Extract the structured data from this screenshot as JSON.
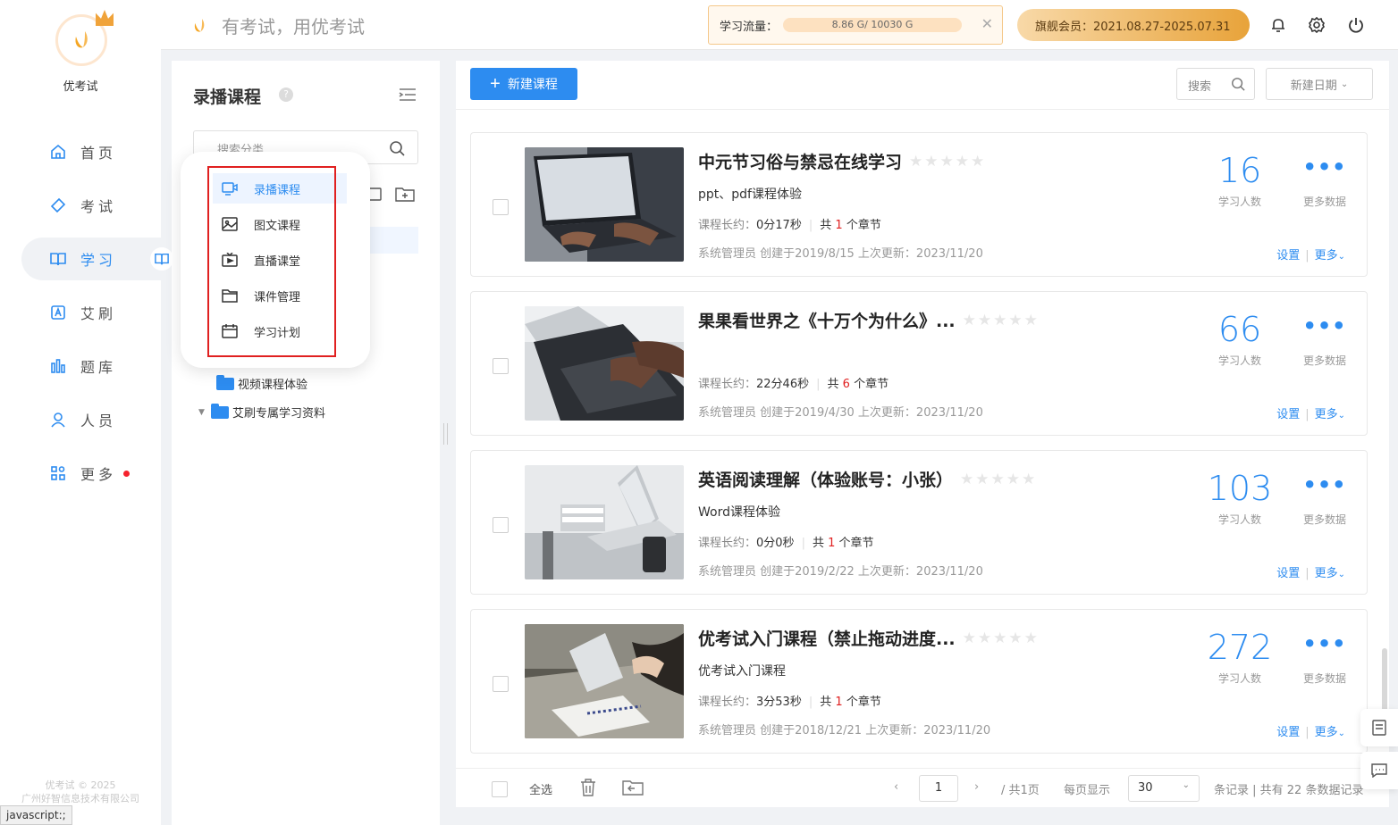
{
  "app": {
    "brand": "优考试",
    "slogan": "有考试，用优考试"
  },
  "nav": [
    {
      "label": "首页",
      "icon": "home-icon",
      "active": false
    },
    {
      "label": "考试",
      "icon": "tag-icon",
      "active": false
    },
    {
      "label": "学习",
      "icon": "book-icon",
      "active": true
    },
    {
      "label": "艾刷",
      "icon": "letter-a-icon",
      "active": false
    },
    {
      "label": "题库",
      "icon": "bars-icon",
      "active": false
    },
    {
      "label": "人员",
      "icon": "user-icon",
      "active": false
    },
    {
      "label": "更多",
      "icon": "grid-icon",
      "active": false,
      "badge_dot": true
    }
  ],
  "footer_copyright": {
    "line1": "优考试 © 2025",
    "line2": "广州好智信息技术有限公司"
  },
  "status_bar": "javascript:;",
  "topbar": {
    "flow_label": "学习流量：",
    "flow_value": "8.86 G/ 10030 G",
    "flow_progress": 0.0009,
    "vip_text": "旗舰会员：2021.08.27-2025.07.31"
  },
  "panel": {
    "title": "录播课程",
    "search_placeholder": "搜索分类",
    "tree": [
      {
        "label": "视频课程体验",
        "expandable": false
      },
      {
        "label": "艾刷专属学习资料",
        "expandable": true
      }
    ]
  },
  "popup_menu": [
    {
      "label": "录播课程",
      "icon": "video-icon",
      "active": true
    },
    {
      "label": "图文课程",
      "icon": "image-icon",
      "active": false
    },
    {
      "label": "直播课堂",
      "icon": "live-icon",
      "active": false
    },
    {
      "label": "课件管理",
      "icon": "folder-icon",
      "active": false
    },
    {
      "label": "学习计划",
      "icon": "calendar-icon",
      "active": false
    }
  ],
  "toolbar": {
    "new_button": "新建课程",
    "search": "搜索",
    "sort": "新建日期"
  },
  "courses": [
    {
      "title": "中元节习俗与禁忌在线学习",
      "desc": "ppt、pdf课程体验",
      "duration_label": "课程长约：",
      "duration": "0分17秒",
      "chapters_prefix": "共",
      "chapters": "1",
      "chapters_suffix": "个章节",
      "creator": "系统管理员 创建于2019/8/15  上次更新：2023/11/20",
      "count": "16",
      "count_label": "学习人数",
      "more_label": "更多数据",
      "rating": 0
    },
    {
      "title": "果果看世界之《十万个为什么》...",
      "desc": "",
      "duration_label": "课程长约：",
      "duration": "22分46秒",
      "chapters_prefix": "共",
      "chapters": "6",
      "chapters_suffix": "个章节",
      "creator": "系统管理员 创建于2019/4/30  上次更新：2023/11/20",
      "count": "66",
      "count_label": "学习人数",
      "more_label": "更多数据",
      "rating": 0
    },
    {
      "title": "英语阅读理解（体验账号：小张）",
      "desc": "Word课程体验",
      "duration_label": "课程长约：",
      "duration": "0分0秒",
      "chapters_prefix": "共",
      "chapters": "1",
      "chapters_suffix": "个章节",
      "creator": "系统管理员 创建于2019/2/22  上次更新：2023/11/20",
      "count": "103",
      "count_label": "学习人数",
      "more_label": "更多数据",
      "rating": 0
    },
    {
      "title": "优考试入门课程（禁止拖动进度...",
      "desc": "优考试入门课程",
      "duration_label": "课程长约：",
      "duration": "3分53秒",
      "chapters_prefix": "共",
      "chapters": "1",
      "chapters_suffix": "个章节",
      "creator": "系统管理员 创建于2018/12/21  上次更新：2023/11/20",
      "count": "272",
      "count_label": "学习人数",
      "more_label": "更多数据",
      "rating": 0
    }
  ],
  "card_actions": {
    "settings": "设置",
    "more": "更多"
  },
  "pagination": {
    "select_all": "全选",
    "page": "1",
    "total_pages": "/ 共1页",
    "per_page_label": "每页显示",
    "per_page": "30",
    "summary": "条记录 | 共有 22 条数据记录"
  },
  "colors": {
    "accent": "#2d8cf0",
    "vip_start": "#f8d9a8",
    "vip_end": "#e8a33a",
    "danger": "#e02020"
  }
}
